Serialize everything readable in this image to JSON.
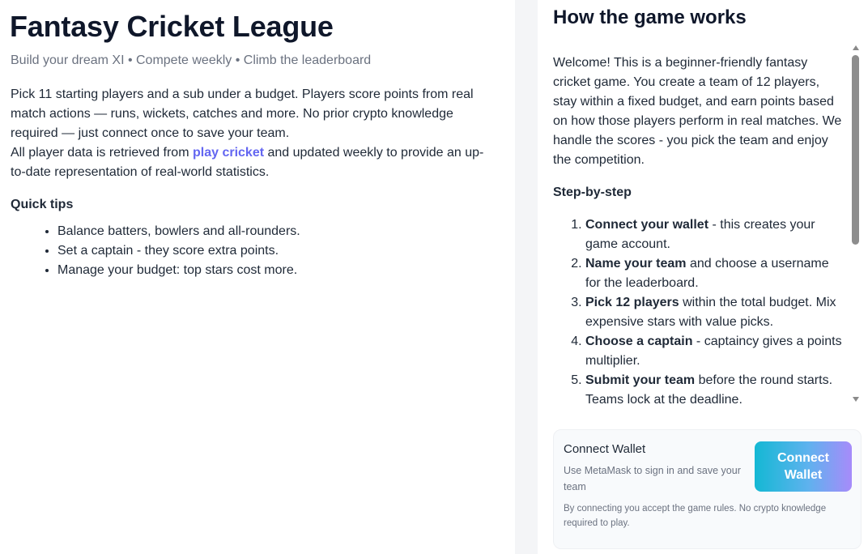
{
  "left": {
    "title": "Fantasy Cricket League",
    "subtitle": "Build your dream XI • Compete weekly • Climb the leaderboard",
    "intro_line1": "Pick 11 starting players and a sub under a budget. Players score points from real match actions — runs, wickets, catches and more. No prior crypto knowledge required — just connect once to save your team.",
    "intro_line2_before": "All player data is retrieved from ",
    "intro_link": "play cricket",
    "intro_line2_after": " and updated weekly to provide an up-to-date representation of real-world statistics.",
    "tips_heading": "Quick tips",
    "tips": [
      "Balance batters, bowlers and all-rounders.",
      "Set a captain - they score extra points.",
      "Manage your budget: top stars cost more."
    ]
  },
  "right": {
    "title": "How the game works",
    "welcome": "Welcome! This is a beginner-friendly fantasy cricket game. You create a team of 12 players, stay within a fixed budget, and earn points based on how those players perform in real matches. We handle the scores - you pick the team and enjoy the competition.",
    "steps_heading": "Step-by-step",
    "steps": [
      {
        "bold": "Connect your wallet",
        "rest": " - this creates your game account."
      },
      {
        "bold": "Name your team",
        "rest": " and choose a username for the leaderboard."
      },
      {
        "bold": "Pick 12 players",
        "rest": " within the total budget. Mix expensive stars with value picks."
      },
      {
        "bold": "Choose a captain",
        "rest": " - captaincy gives a points multiplier."
      },
      {
        "bold": "Submit your team",
        "rest": " before the round starts. Teams lock at the deadline."
      }
    ],
    "scroll_position_fraction": 0.0
  },
  "wallet": {
    "title": "Connect Wallet",
    "description": "Use MetaMask to sign in and save your team",
    "button_label": "Connect Wallet",
    "note": "By connecting you accept the game rules. No crypto knowledge required to play."
  },
  "colors": {
    "link": "#6366f1",
    "heading": "#0f172a",
    "muted": "#6b7280",
    "button_gradient_start": "#14b8d4",
    "button_gradient_end": "#a78bfa",
    "gutter": "#f4f5f7"
  }
}
